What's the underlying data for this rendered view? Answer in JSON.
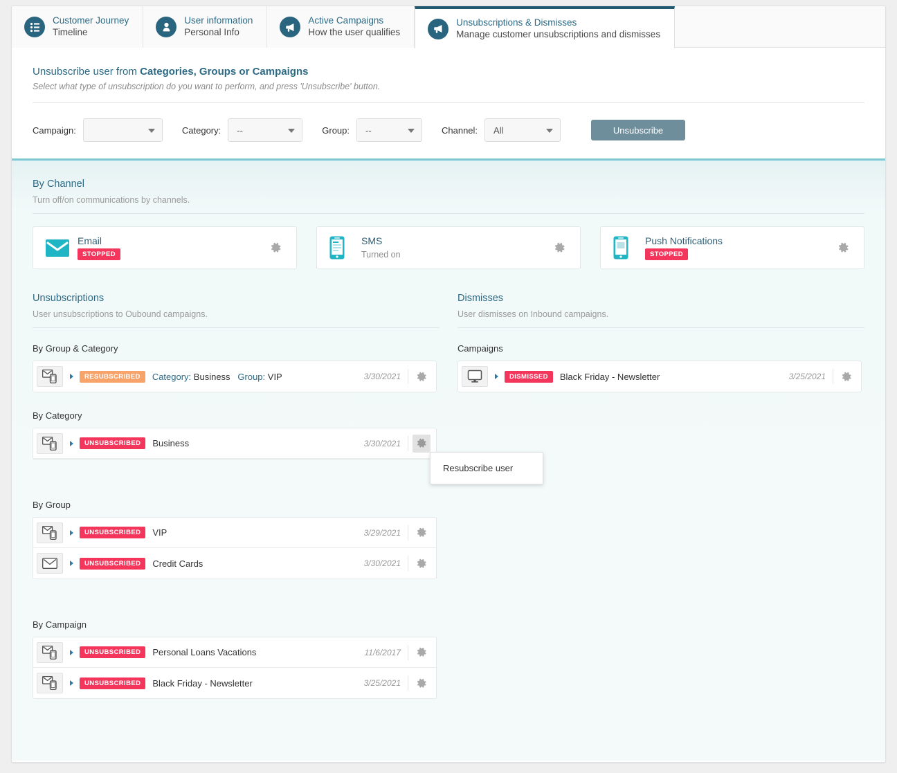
{
  "tabs": [
    {
      "icon": "list-timeline-icon",
      "title": "Customer Journey",
      "subtitle": "Timeline",
      "active": false
    },
    {
      "icon": "user-icon",
      "title": "User information",
      "subtitle": "Personal Info",
      "active": false
    },
    {
      "icon": "megaphone-icon",
      "title": "Active Campaigns",
      "subtitle": "How the user qualifies",
      "active": false
    },
    {
      "icon": "megaphone-icon",
      "title": "Unsubscriptions & Dismisses",
      "subtitle": "Manage customer unsubscriptions and dismisses",
      "active": true
    }
  ],
  "top_panel": {
    "title_normal": "Unsubscribe user from ",
    "title_bold": "Categories, Groups or Campaigns",
    "subtitle": "Select what type of unsubscription do you want to perform, and press 'Unsubscribe' button.",
    "filters": [
      {
        "label": "Campaign:",
        "value": ""
      },
      {
        "label": "Category:",
        "value": "--"
      },
      {
        "label": "Group:",
        "value": "--"
      },
      {
        "label": "Channel:",
        "value": "All"
      }
    ],
    "unsubscribe_button": "Unsubscribe"
  },
  "by_channel": {
    "heading": "By Channel",
    "subtitle": "Turn off/on communications by channels.",
    "cards": [
      {
        "icon": "envelope-icon",
        "name": "Email",
        "badge": "STOPPED",
        "state": "",
        "gear": "gear-icon"
      },
      {
        "icon": "phone-sms-icon",
        "name": "SMS",
        "badge": "",
        "state": "Turned on",
        "gear": "gear-icon"
      },
      {
        "icon": "phone-push-icon",
        "name": "Push Notifications",
        "badge": "STOPPED",
        "state": "",
        "gear": "gear-icon"
      }
    ]
  },
  "unsubscriptions": {
    "heading": "Unsubscriptions",
    "subtitle": "User unsubscriptions to Oubound campaigns.",
    "groups": [
      {
        "heading": "By Group & Category",
        "rows": [
          {
            "icon": "email-mobile-icon",
            "badge": "RESUBSCRIBED",
            "badge_color": "orange",
            "label_parts": [
              {
                "key": "Category:",
                "value": " Business"
              },
              {
                "key": "Group:",
                "value": " VIP"
              }
            ],
            "date": "3/30/2021",
            "gear_active": false
          }
        ]
      },
      {
        "heading": "By Category",
        "rows": [
          {
            "icon": "email-mobile-icon",
            "badge": "UNSUBSCRIBED",
            "badge_color": "red",
            "text": "Business",
            "date": "3/30/2021",
            "gear_active": true,
            "menu": {
              "items": [
                "Resubscribe user"
              ]
            }
          }
        ]
      },
      {
        "heading": "By Group",
        "rows": [
          {
            "icon": "email-mobile-icon",
            "badge": "UNSUBSCRIBED",
            "badge_color": "red",
            "text": "VIP",
            "date": "3/29/2021",
            "gear_active": false
          },
          {
            "icon": "envelope-only-icon",
            "badge": "UNSUBSCRIBED",
            "badge_color": "red",
            "text": "Credit Cards",
            "date": "3/30/2021",
            "gear_active": false
          }
        ]
      },
      {
        "heading": "By Campaign",
        "rows": [
          {
            "icon": "email-mobile-icon",
            "badge": "UNSUBSCRIBED",
            "badge_color": "red",
            "text": "Personal Loans Vacations",
            "date": "11/6/2017",
            "gear_active": false
          },
          {
            "icon": "email-mobile-icon",
            "badge": "UNSUBSCRIBED",
            "badge_color": "red",
            "text": "Black Friday - Newsletter",
            "date": "3/25/2021",
            "gear_active": false
          }
        ]
      }
    ]
  },
  "dismisses": {
    "heading": "Dismisses",
    "subtitle": "User dismisses on Inbound campaigns.",
    "groups": [
      {
        "heading": "Campaigns",
        "rows": [
          {
            "icon": "monitor-icon",
            "badge": "DISMISSED",
            "badge_color": "red",
            "text": "Black Friday - Newsletter",
            "date": "3/25/2021",
            "gear_active": false
          }
        ]
      }
    ]
  },
  "colors": {
    "tab_active_border": "#21596e",
    "tab_icon_bg": "#2a6580",
    "heading_blue": "#2c6a86",
    "badge_red": "#f5365c",
    "badge_orange": "#f7a36a",
    "teal_icon": "#1fb5c4",
    "button_gray_blue": "#6e8e9c",
    "section_top_border": "#7cc9d4"
  }
}
